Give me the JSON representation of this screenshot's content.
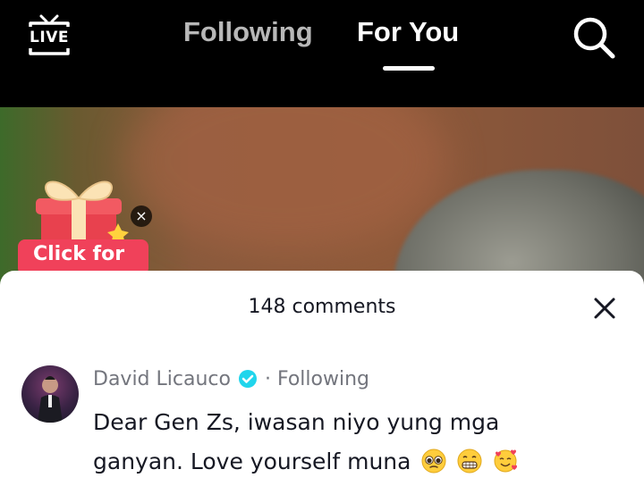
{
  "topbar": {
    "live_label": "LIVE",
    "tabs": [
      {
        "label": "Following",
        "active": false
      },
      {
        "label": "For You",
        "active": true
      }
    ],
    "search_icon": "search-icon"
  },
  "promo": {
    "label": "Click for",
    "close_glyph": "×",
    "icon": "gift-icon"
  },
  "comments": {
    "count_label": "148 comments",
    "close_icon": "close-icon",
    "items": [
      {
        "username": "David Licauco",
        "verified": true,
        "relation": "· Following",
        "text": "Dear Gen Zs, iwasan niyo yung mga ganyan. Love yourself muna",
        "emojis": [
          "pleading-face",
          "grimacing-face",
          "smiling-face-with-hearts"
        ]
      }
    ]
  },
  "colors": {
    "background": "#000000",
    "sheet": "#ffffff",
    "promo_red": "#f0415a",
    "verified_blue": "#20d5ec",
    "muted_text": "#73757d",
    "primary_text": "#161823"
  }
}
